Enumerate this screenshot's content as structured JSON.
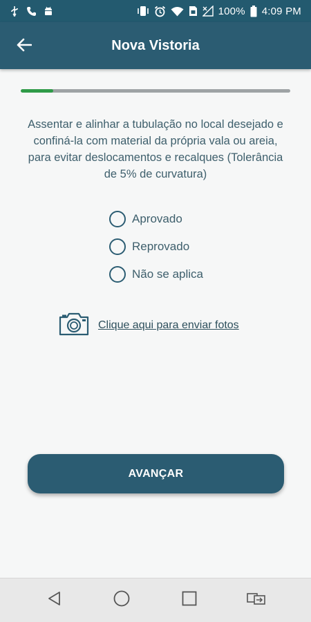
{
  "status_bar": {
    "battery": "100%",
    "time": "4:09 PM",
    "icons_left": [
      "usb-icon",
      "phone-icon",
      "android-icon"
    ],
    "icons_right": [
      "vibrate-icon",
      "alarm-icon",
      "wifi-icon",
      "sim-icon",
      "signal-icon",
      "battery-icon"
    ]
  },
  "app_bar": {
    "title": "Nova Vistoria",
    "back_icon": "arrow-left-icon"
  },
  "progress": {
    "fraction": 0.12,
    "color": "#2f9b48"
  },
  "question": {
    "text": "Assentar e alinhar a tubulação no local desejado e confiná-la com material da própria vala ou areia, para evitar deslocamentos e recalques (Tolerância de 5% de curvatura)"
  },
  "options": [
    {
      "label": "Aprovado",
      "selected": false
    },
    {
      "label": "Reprovado",
      "selected": false
    },
    {
      "label": "Não se aplica",
      "selected": false
    }
  ],
  "photos": {
    "label": "Clique aqui para enviar fotos",
    "icon": "camera-icon"
  },
  "actions": {
    "advance_label": "AVANÇAR"
  },
  "nav_bar": {
    "icons": [
      "back-triangle-icon",
      "home-circle-icon",
      "recents-square-icon",
      "switch-apps-icon"
    ]
  },
  "colors": {
    "primary": "#2b5c72",
    "text": "#3e5f6c",
    "background": "#f6f7f7"
  }
}
